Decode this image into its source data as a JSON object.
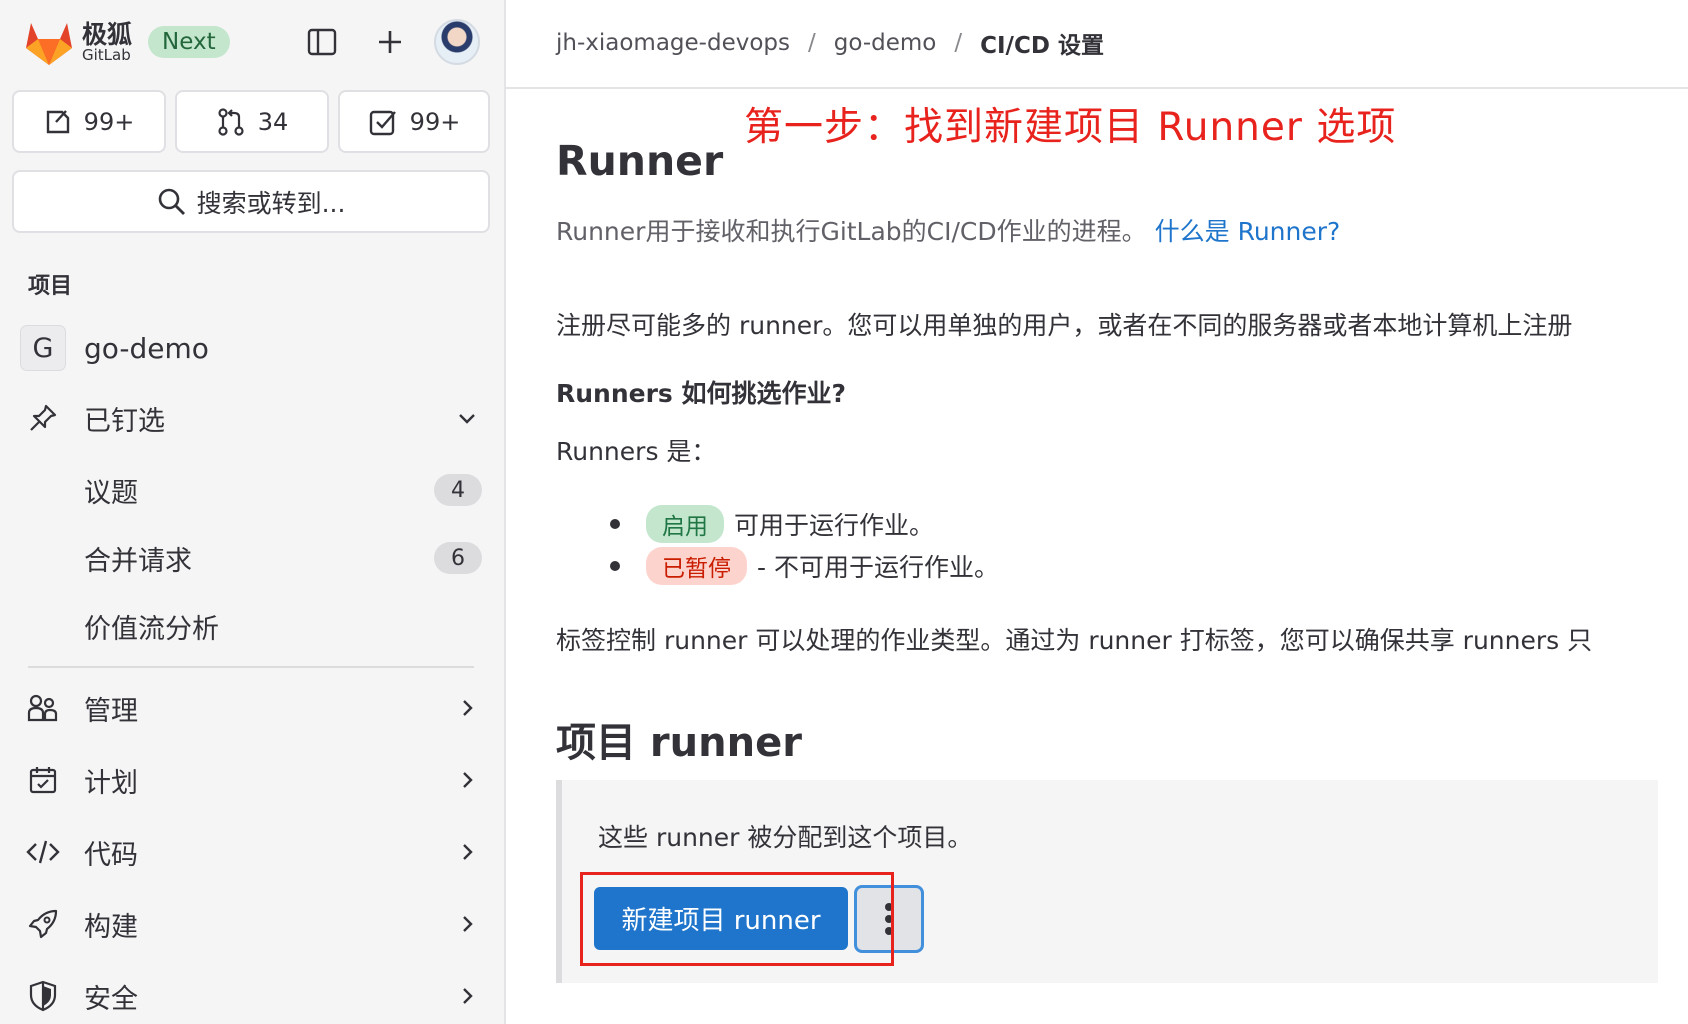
{
  "brand": {
    "name_cn": "极狐",
    "name_en": "GitLab",
    "badge": "Next"
  },
  "counters": [
    {
      "icon": "issues-icon",
      "value": "99+"
    },
    {
      "icon": "merge-request-icon",
      "value": "34"
    },
    {
      "icon": "todo-icon",
      "value": "99+"
    }
  ],
  "search": {
    "label": "搜索或转到..."
  },
  "sidebar": {
    "section_title": "项目",
    "project": {
      "initial": "G",
      "name": "go-demo"
    },
    "pinned": {
      "label": "已钉选",
      "items": [
        {
          "label": "议题",
          "count": "4"
        },
        {
          "label": "合并请求",
          "count": "6"
        },
        {
          "label": "价值流分析"
        }
      ]
    },
    "groups": [
      {
        "label": "管理",
        "icon": "users-icon"
      },
      {
        "label": "计划",
        "icon": "calendar-icon"
      },
      {
        "label": "代码",
        "icon": "code-icon"
      },
      {
        "label": "构建",
        "icon": "rocket-icon"
      },
      {
        "label": "安全",
        "icon": "shield-icon"
      }
    ]
  },
  "breadcrumb": [
    "jh-xiaomage-devops",
    "go-demo",
    "CI/CD 设置"
  ],
  "annotation": "第一步：找到新建项目 Runner 选项",
  "page": {
    "title": "Runner",
    "description": "Runner用于接收和执行GitLab的CI/CD作业的进程。",
    "help_link": "什么是 Runner?",
    "register_text": "注册尽可能多的 runner。您可以用单独的用户，或者在不同的服务器或者本地计算机上注册",
    "pick_heading": "Runners 如何挑选作业?",
    "runners_are": "Runners 是：",
    "status_active_badge": "启用",
    "status_active_text": "可用于运行作业。",
    "status_paused_badge": "已暂停",
    "status_paused_text": "- 不可用于运行作业。",
    "tags_text": "标签控制 runner 可以处理的作业类型。通过为 runner 打标签，您可以确保共享 runners 只",
    "project_runners_title": "项目 runner",
    "card_text": "这些 runner 被分配到这个项目。",
    "new_runner_button": "新建项目 runner"
  },
  "colors": {
    "primary": "#1f75cb",
    "annotation": "#e8221d",
    "active": "#c3e6cd",
    "paused": "#fdd4cd"
  }
}
